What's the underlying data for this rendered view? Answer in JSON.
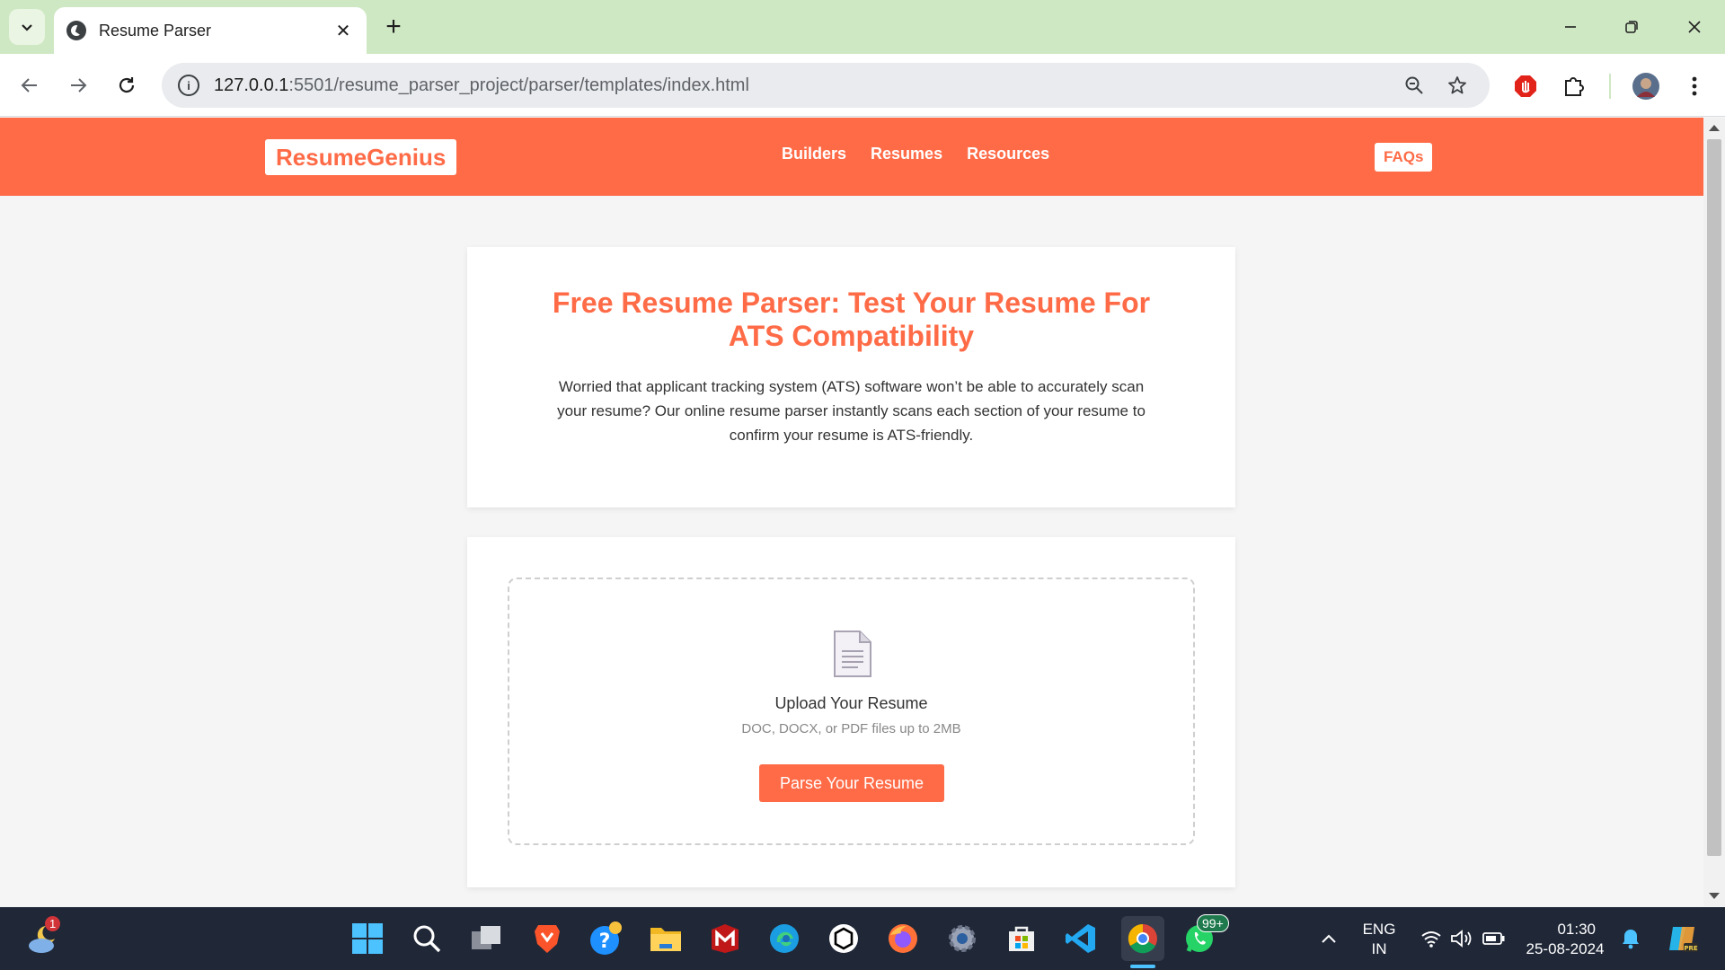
{
  "browser": {
    "tab_title": "Resume Parser",
    "url_host": "127.0.0.1",
    "url_path": ":5501/resume_parser_project/parser/templates/index.html"
  },
  "site": {
    "logo": "ResumeGenius",
    "nav": [
      "Builders",
      "Resumes",
      "Resources"
    ],
    "faq_label": "FAQs"
  },
  "intro": {
    "title": "Free Resume Parser: Test Your Resume For ATS Compatibility",
    "description": "Worried that applicant tracking system (ATS) software won’t be able to accurately scan your resume? Our online resume parser instantly scans each section of your resume to confirm your resume is ATS-friendly."
  },
  "upload": {
    "title": "Upload Your Resume",
    "subtitle": "DOC, DOCX, or PDF files up to 2MB",
    "button": "Parse Your Resume"
  },
  "taskbar": {
    "weather_badge": "1",
    "whatsapp_badge": "99+",
    "lang_top": "ENG",
    "lang_bottom": "IN",
    "time": "01:30",
    "date": "25-08-2024"
  },
  "colors": {
    "brand": "#ff6b47",
    "tabbar": "#cfe8c4",
    "taskbar": "#202838"
  }
}
